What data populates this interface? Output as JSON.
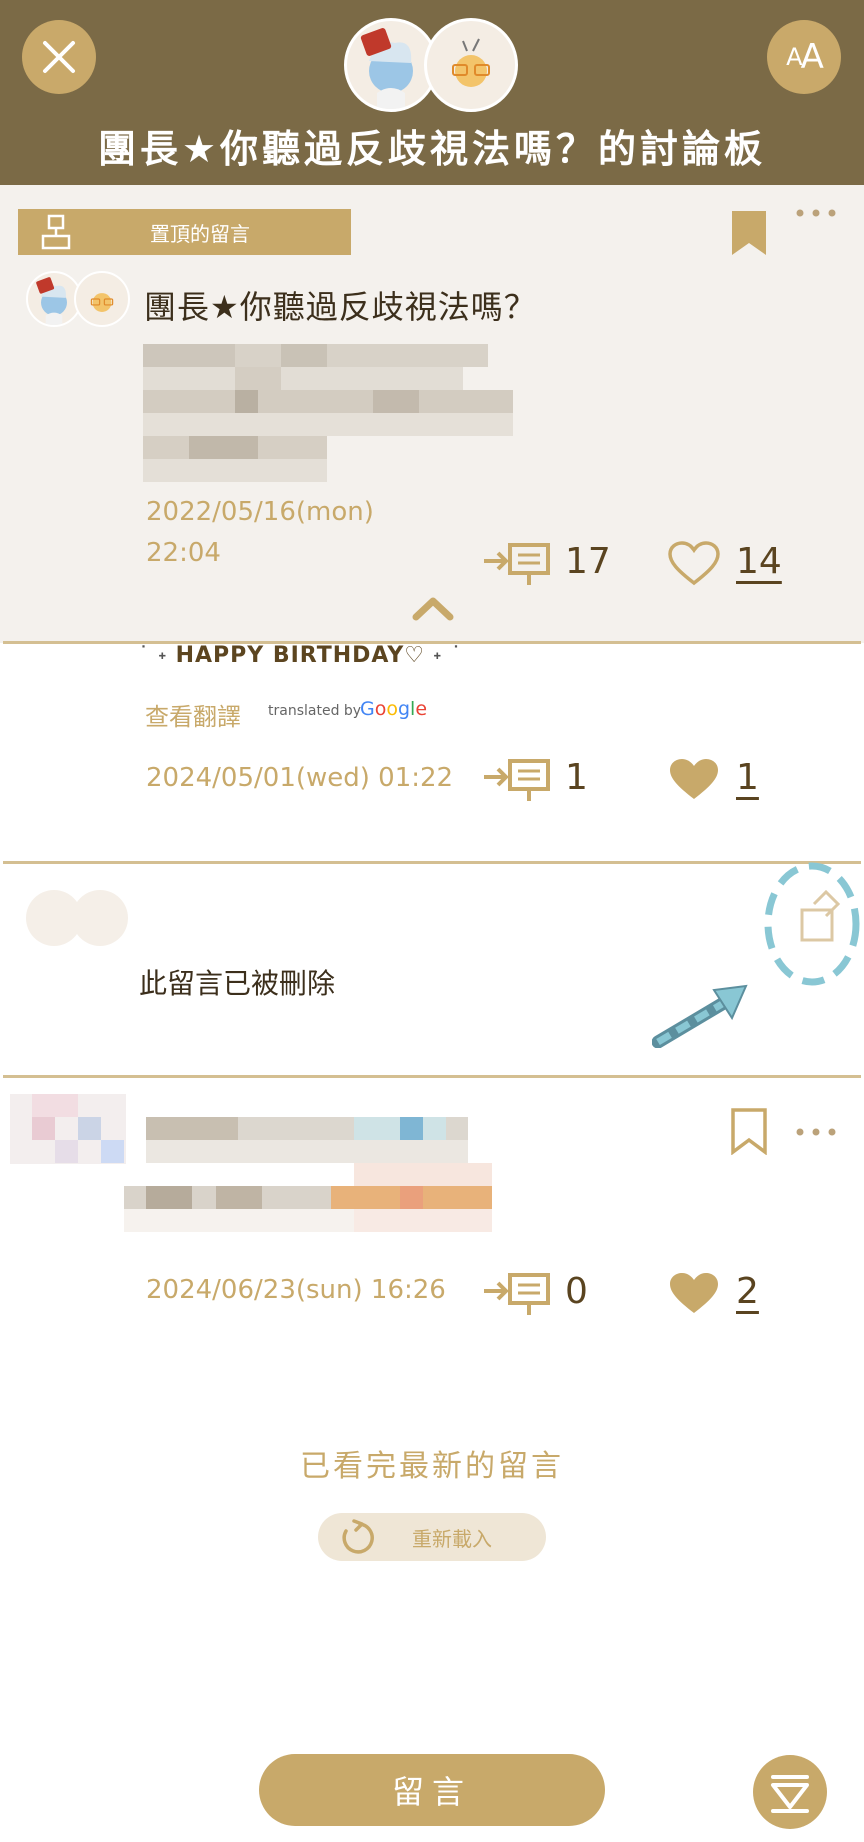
{
  "header": {
    "title": "團長★你聽過反歧視法嗎？的討論板",
    "font_button_label_small": "A",
    "font_button_label_large": "A"
  },
  "pinned": {
    "tag_label": "置頂的留言",
    "title": "團長★你聽過反歧視法嗎？",
    "date": "2022/05/16(mon)",
    "time": "22:04",
    "reply_count": "17",
    "like_count": "14"
  },
  "comments": [
    {
      "text": "HAPPY BIRTHDAY♡",
      "translate_link": "查看翻譯",
      "translated_by": "translated by",
      "google_label": "Google",
      "datetime": "2024/05/01(wed) 01:22",
      "reply_count": "1",
      "like_count": "1"
    },
    {
      "deleted_text": "此留言已被刪除"
    },
    {
      "datetime": "2024/06/23(sun) 16:26",
      "reply_count": "0",
      "like_count": "2"
    }
  ],
  "footer": {
    "loaded_text": "已看完最新的留言",
    "reload_label": "重新載入",
    "comment_button_label": "留言"
  },
  "colors": {
    "header_bg": "#7b6a46",
    "accent": "#c8a96a",
    "pinned_bg": "#f4f1ed",
    "annotation": "#89c7d4"
  }
}
